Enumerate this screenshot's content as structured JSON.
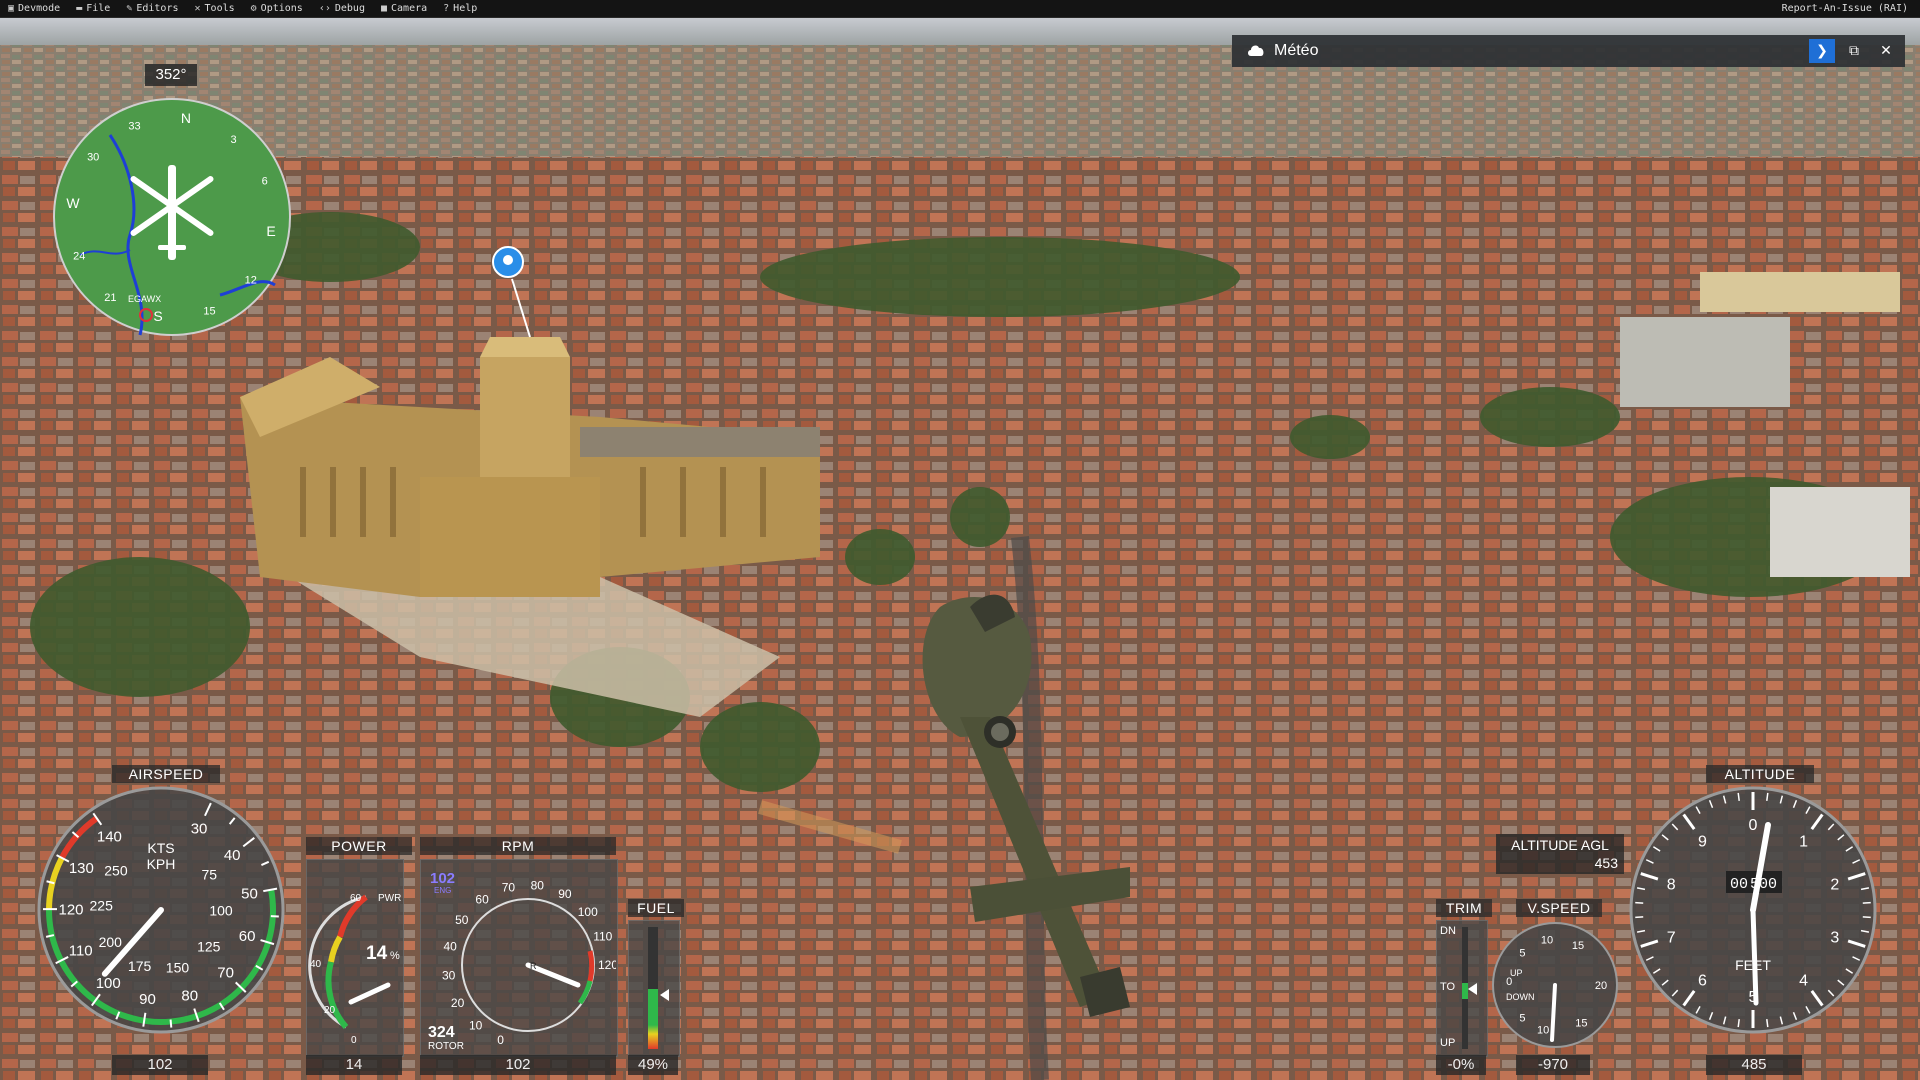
{
  "menubar": {
    "items": [
      {
        "label": "Devmode",
        "icon": "devmode-icon",
        "glyph": "▣"
      },
      {
        "label": "File",
        "icon": "folder-icon",
        "glyph": "▬"
      },
      {
        "label": "Editors",
        "icon": "pencil-icon",
        "glyph": "✎"
      },
      {
        "label": "Tools",
        "icon": "tools-icon",
        "glyph": "✕"
      },
      {
        "label": "Options",
        "icon": "gear-icon",
        "glyph": "⚙"
      },
      {
        "label": "Debug",
        "icon": "code-icon",
        "glyph": "‹›"
      },
      {
        "label": "Camera",
        "icon": "camera-icon",
        "glyph": "■"
      },
      {
        "label": "Help",
        "icon": "help-icon",
        "glyph": "?"
      }
    ],
    "report_issue": "Report-An-Issue (RAI)"
  },
  "meteo": {
    "title": "Météo",
    "icon": "cloud-icon",
    "buttons": [
      "chevron-right-icon",
      "popout-icon",
      "close-icon"
    ]
  },
  "compass": {
    "heading_label": "352°",
    "heading": 352,
    "waypoint": "EGAWX",
    "ring_labels": [
      "N",
      "3",
      "6",
      "E",
      "12",
      "15",
      "S",
      "21",
      "24",
      "W",
      "30",
      "33"
    ]
  },
  "airspeed": {
    "label": "AIRSPEED",
    "units_kts": "KTS",
    "units_kph": "KPH",
    "value": "102",
    "kts_labels": [
      "30",
      "40",
      "50",
      "60",
      "70",
      "80",
      "90",
      "100",
      "110",
      "120",
      "130",
      "140"
    ],
    "kph_labels": [
      "75",
      "100",
      "125",
      "150",
      "175",
      "200",
      "225",
      "250"
    ],
    "needle_kts": 102
  },
  "power": {
    "label": "POWER",
    "sublabel": "PWR",
    "percent": "14",
    "percent_sign": "%",
    "value": "14",
    "ticks": [
      "0",
      "20",
      "40",
      "60"
    ],
    "level": 14
  },
  "rpm": {
    "label": "RPM",
    "eng_value": "102",
    "eng_label": "ENG",
    "rotor_value": "324",
    "rotor_label": "ROTOR",
    "value": "102",
    "ticks": [
      "0",
      "10",
      "20",
      "30",
      "40",
      "50",
      "60",
      "70",
      "80",
      "90",
      "100",
      "110",
      "120"
    ]
  },
  "fuel": {
    "label": "FUEL",
    "value": "49%",
    "level": 0.49
  },
  "trim": {
    "label": "TRIM",
    "dn": "DN",
    "to": "TO",
    "up": "UP",
    "value": "-0%"
  },
  "vspeed": {
    "label": "V.SPEED",
    "up": "UP",
    "down": "DOWN",
    "value": "-970",
    "ticks": [
      "10",
      "15",
      "20",
      "15",
      "10",
      "5",
      "0",
      "5"
    ]
  },
  "altitude_agl": {
    "label": "ALTITUDE AGL",
    "value": "453"
  },
  "altitude": {
    "label": "ALTITUDE",
    "units": "FEET",
    "value": "485",
    "drum": "00",
    "drum_hundreds": "500",
    "dial_labels": [
      "0",
      "1",
      "2",
      "3",
      "4",
      "5",
      "6",
      "7",
      "8",
      "9"
    ]
  },
  "colors": {
    "hud_panel": "#4a4a4a",
    "green_arc": "#2fb84a",
    "yellow_arc": "#e8d120",
    "red_arc": "#e03a2a",
    "blue_accent": "#1f6fd6",
    "eng_blue": "#8a7cff"
  }
}
